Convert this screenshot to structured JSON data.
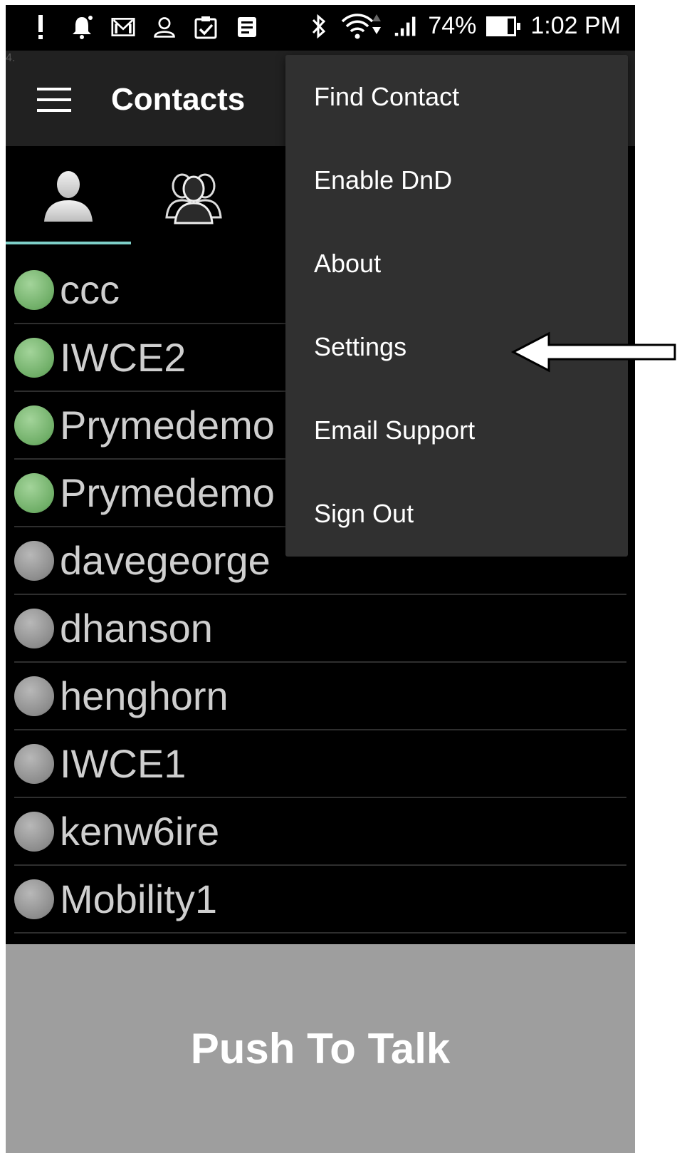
{
  "step_label": "4.",
  "status_bar": {
    "left_icons": [
      "alert-icon",
      "notification-bell-icon",
      "gmail-icon",
      "contacts-icon",
      "clipboard-check-icon",
      "news-icon"
    ],
    "right_icons": [
      "bluetooth-icon",
      "wifi-icon",
      "cell-signal-icon"
    ],
    "battery_percent_text": "74%",
    "battery_level": 0.74,
    "time": "1:02 PM"
  },
  "app_bar": {
    "title": "Contacts",
    "menu_icon": "hamburger-menu-icon"
  },
  "tabs": [
    {
      "icon": "single-user-icon",
      "selected": true
    },
    {
      "icon": "user-group-icon",
      "selected": false
    }
  ],
  "contacts": [
    {
      "name": "ccc",
      "status": "online"
    },
    {
      "name": "IWCE2",
      "status": "online"
    },
    {
      "name": "Prymedemo",
      "status": "online"
    },
    {
      "name": "Prymedemo",
      "status": "online"
    },
    {
      "name": "davegeorge",
      "status": "offline"
    },
    {
      "name": "dhanson",
      "status": "offline"
    },
    {
      "name": "henghorn",
      "status": "offline"
    },
    {
      "name": "IWCE1",
      "status": "offline"
    },
    {
      "name": "kenw6ire",
      "status": "offline"
    },
    {
      "name": "Mobility1",
      "status": "offline"
    }
  ],
  "menu": {
    "items": [
      "Find Contact",
      "Enable DnD",
      "About",
      "Settings",
      "Email Support",
      "Sign Out"
    ]
  },
  "push_to_talk": {
    "label": "Push To Talk"
  },
  "colors": {
    "online": "#6fae67",
    "offline": "#8c8c8c",
    "tab_indicator": "#7ecfc8",
    "ptt_background": "#9e9e9e",
    "menu_background": "#303030"
  }
}
